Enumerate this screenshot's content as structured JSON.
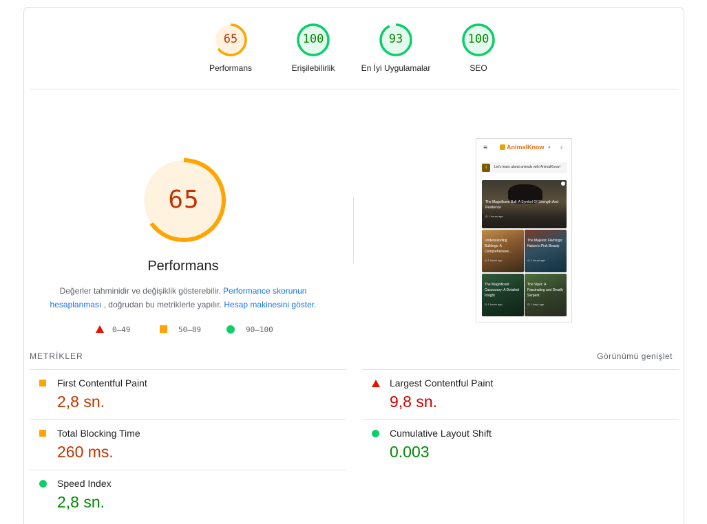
{
  "scores": [
    {
      "label": "Performans",
      "value": "65",
      "score": 65,
      "color": "#ffa400",
      "fill": "#fff3e0",
      "text_color": "#c33300"
    },
    {
      "label": "Erişilebilirlik",
      "value": "100",
      "score": 100,
      "color": "#0cce6b",
      "fill": "#e6f9ee",
      "text_color": "#008800"
    },
    {
      "label": "En İyi Uygulamalar",
      "value": "93",
      "score": 93,
      "color": "#0cce6b",
      "fill": "#e6f9ee",
      "text_color": "#008800"
    },
    {
      "label": "SEO",
      "value": "100",
      "score": 100,
      "color": "#0cce6b",
      "fill": "#e6f9ee",
      "text_color": "#008800"
    }
  ],
  "performance": {
    "score": "65",
    "score_value": 65,
    "title": "Performans",
    "desc_text_1": "Değerler tahminidir ve değişiklik gösterebilir.",
    "desc_link_1": "Performance skorunun hesaplanması",
    "desc_text_2": ", doğrudan bu metriklerle yapılır.",
    "desc_link_2": "Hesap makinesini göster."
  },
  "legend": {
    "poor": "0–49",
    "average": "50–89",
    "good": "90–100"
  },
  "screenshot": {
    "logo": "AnimalKnow",
    "banner": "Let's learn about animals with AnimalKnow!",
    "hero_title": "The Magnificent Bull: A Symbol Of Strength And Resilience",
    "hero_meta": "1 hours ago",
    "cards": [
      {
        "title": "Understanding Bulldogs: A Comprehensive...",
        "meta": "1 hours ago"
      },
      {
        "title": "The Majestic Flamingo: Nature's Pink Beauty",
        "meta": "1 hours ago"
      },
      {
        "title": "The Magnificent Cassowary: A Detailed Insight",
        "meta": "1 hours ago"
      },
      {
        "title": "The Viper: A Fascinating and Deadly Serpent",
        "meta": "1 days ago"
      }
    ]
  },
  "metrics": {
    "heading": "METRİKLER",
    "expand_label": "Görünümü genişlet",
    "items": [
      {
        "name": "First Contentful Paint",
        "value": "2,8 sn.",
        "status": "average"
      },
      {
        "name": "Largest Contentful Paint",
        "value": "9,8 sn.",
        "status": "poor"
      },
      {
        "name": "Total Blocking Time",
        "value": "260 ms.",
        "status": "average"
      },
      {
        "name": "Cumulative Layout Shift",
        "value": "0.003",
        "status": "good"
      },
      {
        "name": "Speed Index",
        "value": "2,8 sn.",
        "status": "good"
      }
    ]
  }
}
